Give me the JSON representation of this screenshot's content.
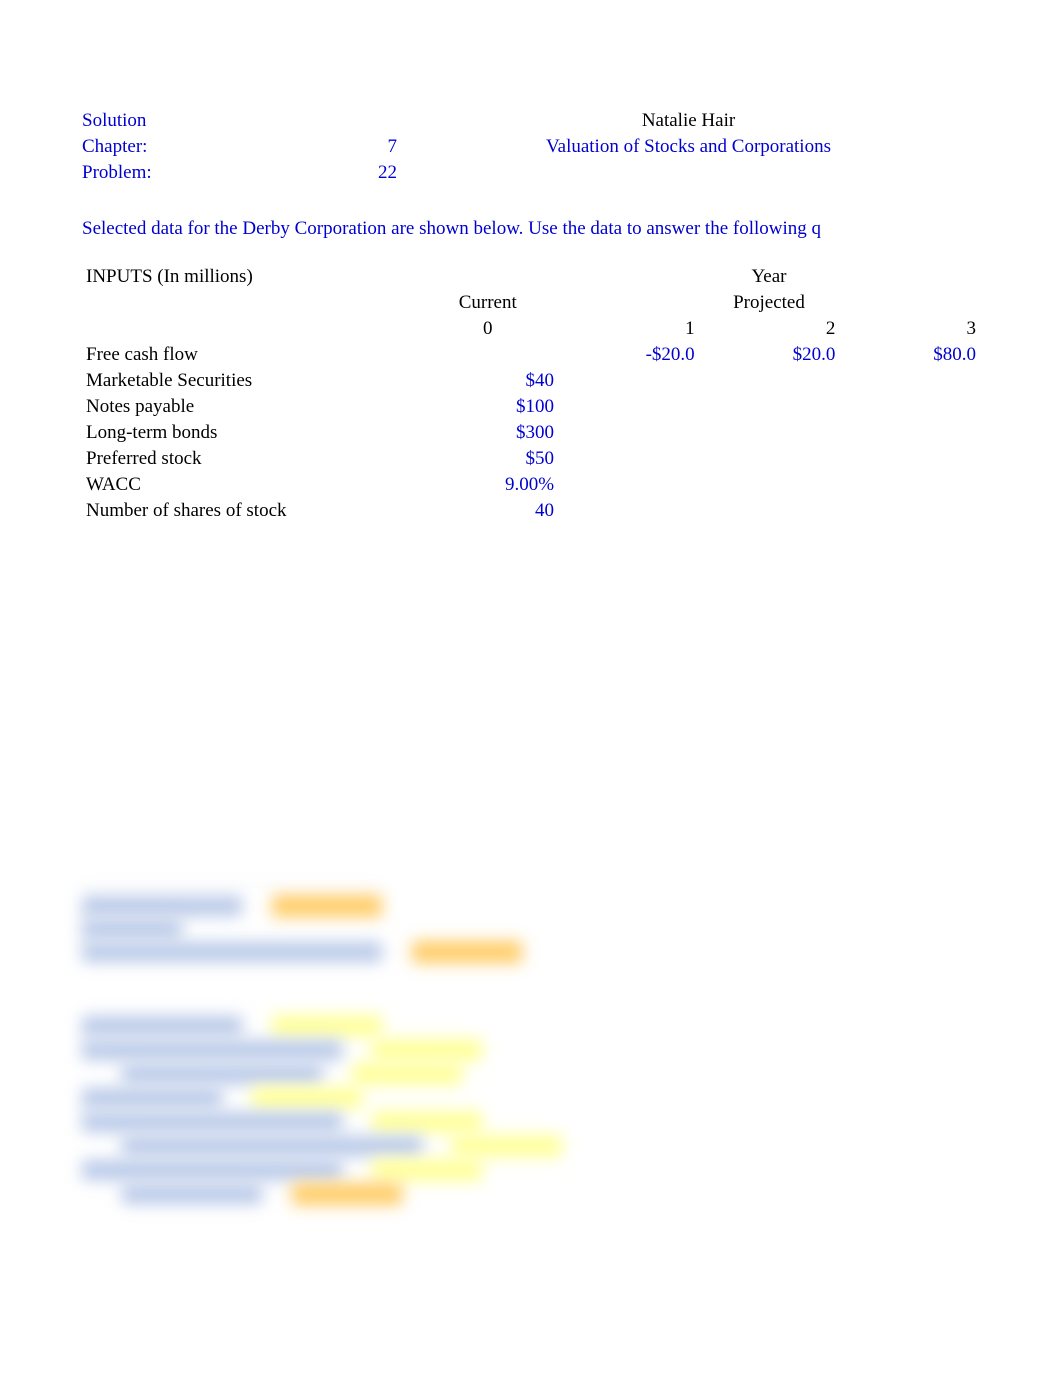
{
  "header": {
    "solution_label": "Solution",
    "student_name": "Natalie Hair",
    "chapter_label": "Chapter:",
    "chapter_num": "7",
    "chapter_title": "Valuation of Stocks and Corporations",
    "problem_label": "Problem:",
    "problem_num": "22"
  },
  "prompt": "Selected data for the Derby Corporation are shown below. Use the data to answer the following q",
  "inputs_title": "INPUTS (In millions)",
  "year_label": "Year",
  "col_headers": {
    "current": "Current",
    "projected": "Projected",
    "y0": "0",
    "y1": "1",
    "y2": "2",
    "y3": "3"
  },
  "rows": {
    "fcf_label": "Free cash flow",
    "fcf_1": "-$20.0",
    "fcf_2": "$20.0",
    "fcf_3": "$80.0",
    "ms_label": "Marketable Securities",
    "ms_0": "$40",
    "np_label": "Notes payable",
    "np_0": "$100",
    "ltb_label": "Long-term bonds",
    "ltb_0": "$300",
    "ps_label": "Preferred stock",
    "ps_0": "$50",
    "wacc_label": "WACC",
    "wacc_0": "9.00%",
    "shares_label": "Number of shares of stock",
    "shares_0": "40"
  }
}
